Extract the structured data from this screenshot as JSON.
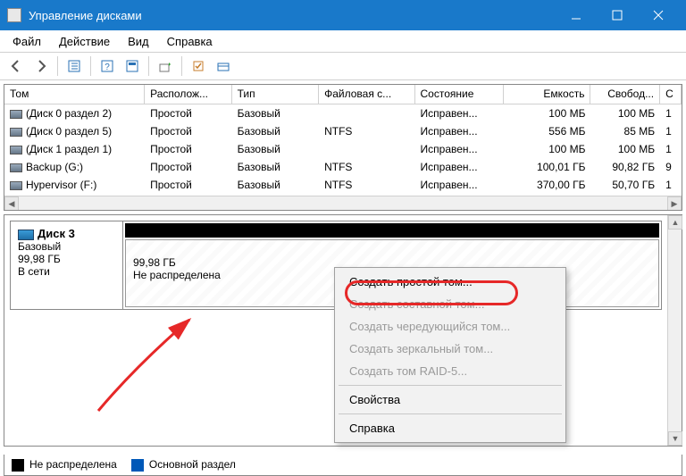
{
  "window": {
    "title": "Управление дисками"
  },
  "menu": {
    "file": "Файл",
    "action": "Действие",
    "view": "Вид",
    "help": "Справка"
  },
  "columns": [
    "Том",
    "Располож...",
    "Тип",
    "Файловая с...",
    "Состояние",
    "Емкость",
    "Свобод...",
    "С"
  ],
  "volumes": [
    {
      "name": "(Диск 0 раздел 2)",
      "layout": "Простой",
      "type": "Базовый",
      "fs": "",
      "status": "Исправен...",
      "capacity": "100 МБ",
      "free": "100 МБ",
      "pct": "1"
    },
    {
      "name": "(Диск 0 раздел 5)",
      "layout": "Простой",
      "type": "Базовый",
      "fs": "NTFS",
      "status": "Исправен...",
      "capacity": "556 МБ",
      "free": "85 МБ",
      "pct": "1"
    },
    {
      "name": "(Диск 1 раздел 1)",
      "layout": "Простой",
      "type": "Базовый",
      "fs": "",
      "status": "Исправен...",
      "capacity": "100 МБ",
      "free": "100 МБ",
      "pct": "1"
    },
    {
      "name": "Backup (G:)",
      "layout": "Простой",
      "type": "Базовый",
      "fs": "NTFS",
      "status": "Исправен...",
      "capacity": "100,01 ГБ",
      "free": "90,82 ГБ",
      "pct": "9"
    },
    {
      "name": "Hypervisor (F:)",
      "layout": "Простой",
      "type": "Базовый",
      "fs": "NTFS",
      "status": "Исправен...",
      "capacity": "370,00 ГБ",
      "free": "50,70 ГБ",
      "pct": "1"
    }
  ],
  "disk": {
    "name": "Диск 3",
    "type": "Базовый",
    "size": "99,98 ГБ",
    "status": "В сети",
    "vol_size": "99,98 ГБ",
    "vol_status": "Не распределена"
  },
  "legend": {
    "unallocated": "Не распределена",
    "primary": "Основной раздел"
  },
  "ctx": {
    "simple": "Создать простой том...",
    "spanned": "Создать составной том...",
    "striped": "Создать чередующийся том...",
    "mirrored": "Создать зеркальный том...",
    "raid5": "Создать том RAID-5...",
    "props": "Свойства",
    "help": "Справка"
  }
}
